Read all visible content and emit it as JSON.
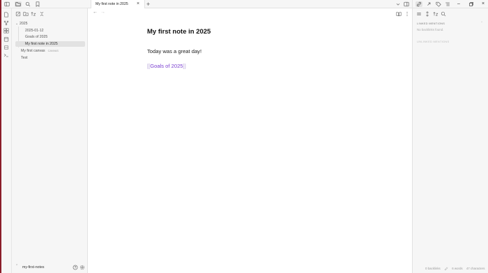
{
  "colors": {
    "accent": "#7a3fd0",
    "window_edge": "#8b1d2a",
    "sidebar_bg": "#f6f6f6",
    "editor_bg": "#ffffff"
  },
  "explorer": {
    "items": [
      {
        "label": "2025",
        "type": "folder",
        "expanded": true
      },
      {
        "label": "2025-01-12",
        "type": "file",
        "child": true
      },
      {
        "label": "Goals of 2025",
        "type": "file",
        "child": true
      },
      {
        "label": "My first note in 2025",
        "type": "file",
        "child": true,
        "active": true
      },
      {
        "label": "My first canvas",
        "badge": "CANVAS",
        "type": "file"
      },
      {
        "label": "Test",
        "type": "file"
      }
    ],
    "vault_name": "my-first-notes"
  },
  "tabs": [
    {
      "label": "My first note in 2025",
      "active": true
    }
  ],
  "editor": {
    "title": "My first note in 2025",
    "body": "Today was a great day!",
    "link": {
      "open": "[[",
      "text": "Goals of 2025",
      "close": "]]"
    }
  },
  "backlinks": {
    "linked_heading": "LINKED MENTIONS",
    "linked_empty": "No backlinks found.",
    "unlinked_heading": "UNLINKED MENTIONS"
  },
  "statusbar": {
    "backlinks": "0 backlinks",
    "words": "6 words",
    "characters": "47 characters"
  },
  "icons": {
    "top_left": [
      "sidebar-toggle-icon",
      "files-icon",
      "search-icon",
      "bookmark-icon"
    ],
    "ribbon": [
      "file-plus-icon",
      "graph-icon",
      "canvas-icon",
      "calendar-icon",
      "template-icon",
      "terminal-icon"
    ],
    "explorer_actions": [
      "new-note-icon",
      "new-folder-icon",
      "sort-icon",
      "collapse-all-icon"
    ],
    "window": [
      "backlinks-icon",
      "outgoing-links-icon",
      "tags-icon",
      "outline-icon",
      "minimize-icon",
      "restore-icon",
      "close-icon"
    ],
    "right_tools": [
      "list-icon",
      "sort-icon",
      "filter-icon",
      "search-icon"
    ]
  }
}
